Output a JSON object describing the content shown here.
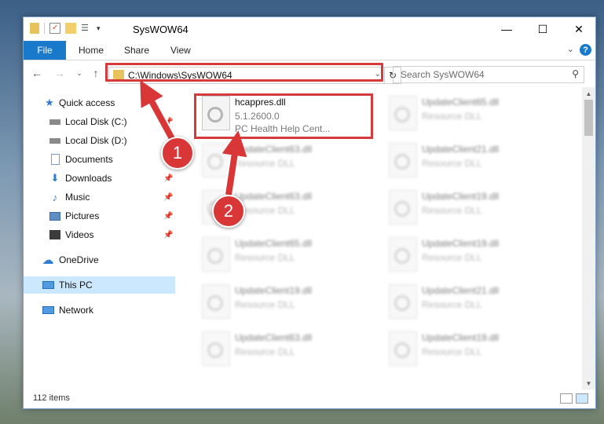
{
  "window": {
    "title": "SysWOW64",
    "controls": {
      "minimize": "—",
      "maximize": "☐",
      "close": "✕"
    }
  },
  "ribbon": {
    "file": "File",
    "tabs": [
      "Home",
      "Share",
      "View"
    ],
    "help": "?"
  },
  "nav": {
    "address": "C:\\Windows\\SysWOW64",
    "search_placeholder": "Search SysWOW64"
  },
  "sidebar": {
    "items": [
      {
        "label": "Quick access"
      },
      {
        "label": "Local Disk (C:)"
      },
      {
        "label": "Local Disk (D:)"
      },
      {
        "label": "Documents"
      },
      {
        "label": "Downloads"
      },
      {
        "label": "Music"
      },
      {
        "label": "Pictures"
      },
      {
        "label": "Videos"
      },
      {
        "label": "OneDrive"
      },
      {
        "label": "This PC"
      },
      {
        "label": "Network"
      }
    ]
  },
  "files": {
    "main": {
      "name": "hcappres.dll",
      "version": "5.1.2600.0",
      "description": "PC Health Help Cent..."
    },
    "blurred": [
      {
        "name": "UpdateClient65.dll",
        "type": "Resource DLL"
      },
      {
        "name": "UpdateClient63.dll",
        "type": "Resource DLL"
      },
      {
        "name": "UpdateClient21.dll",
        "type": "Resource DLL"
      },
      {
        "name": "UpdateClient63.dll",
        "type": "Resource DLL"
      },
      {
        "name": "UpdateClient19.dll",
        "type": "Resource DLL"
      },
      {
        "name": "UpdateClient65.dll",
        "type": "Resource DLL"
      },
      {
        "name": "UpdateClient19.dll",
        "type": "Resource DLL"
      },
      {
        "name": "UpdateClient19.dll",
        "type": "Resource DLL"
      },
      {
        "name": "UpdateClient21.dll",
        "type": "Resource DLL"
      },
      {
        "name": "UpdateClient63.dll",
        "type": "Resource DLL"
      },
      {
        "name": "UpdateClient19.dll",
        "type": "Resource DLL"
      }
    ]
  },
  "status": {
    "count": "112 items"
  },
  "callouts": {
    "one": "1",
    "two": "2"
  },
  "colors": {
    "accent": "#1979ca",
    "highlight": "#d53b3b",
    "selected": "#cce8ff"
  }
}
